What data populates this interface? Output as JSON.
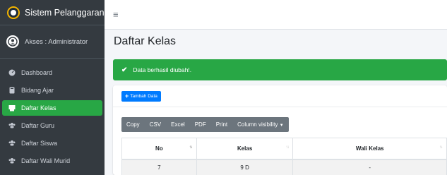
{
  "brand": {
    "name": "Sistem Pelanggaran",
    "logo_icon": "school-logo-icon"
  },
  "user": {
    "access": "Akses : Administrator",
    "avatar_icon": "user-circle-icon"
  },
  "sidebar": {
    "items": [
      {
        "label": "Dashboard",
        "icon": "dashboard-icon"
      },
      {
        "label": "Bidang Ajar",
        "icon": "book-icon"
      },
      {
        "label": "Daftar Kelas",
        "icon": "class-icon",
        "active": true
      },
      {
        "label": "Daftar Guru",
        "icon": "users-icon"
      },
      {
        "label": "Daftar Siswa",
        "icon": "users-icon"
      },
      {
        "label": "Daftar Wali Murid",
        "icon": "users-icon"
      }
    ]
  },
  "topbar": {
    "menu_icon": "hamburger-icon"
  },
  "page": {
    "title": "Daftar Kelas"
  },
  "alert": {
    "message": "Data berhasil diubah!.",
    "icon": "check-icon"
  },
  "toolbar": {
    "add_label": "Tambah Data"
  },
  "export_buttons": [
    "Copy",
    "CSV",
    "Excel",
    "PDF",
    "Print",
    "Column visibility"
  ],
  "table": {
    "headers": [
      "No",
      "Kelas",
      "Wali Kelas"
    ],
    "rows": [
      [
        "7",
        "9 D",
        "-"
      ]
    ]
  },
  "colors": {
    "sidebar": "#343a40",
    "success": "#28a745",
    "primary": "#007bff",
    "export": "#6c757d"
  }
}
